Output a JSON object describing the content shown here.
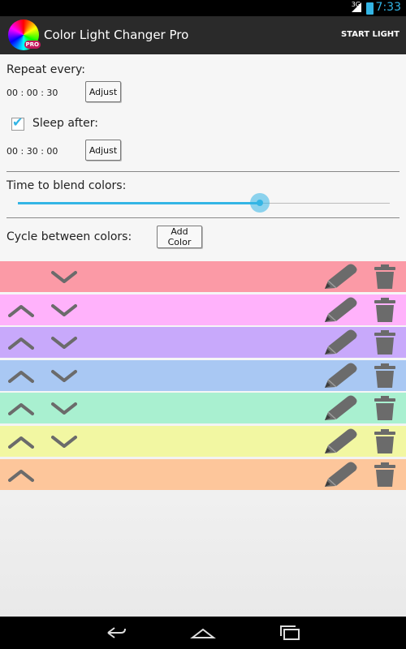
{
  "status_bar": {
    "network": "3G",
    "time": "7:33"
  },
  "action_bar": {
    "title": "Color Light Changer Pro",
    "badge": "PRO",
    "action": "START LIGHT"
  },
  "repeat": {
    "label": "Repeat every:",
    "value": "00 : 00 : 30",
    "button": "Adjust"
  },
  "sleep": {
    "label": "Sleep after:",
    "checked": true,
    "value": "00 : 30 : 00",
    "button": "Adjust"
  },
  "blend": {
    "label": "Time to blend colors:",
    "fraction": 0.65
  },
  "cycle": {
    "label": "Cycle between colors:",
    "button": "Add Color"
  },
  "colors": [
    {
      "hex": "#fb9aa6",
      "up": false,
      "down": true
    },
    {
      "hex": "#ffb2fb",
      "up": true,
      "down": true
    },
    {
      "hex": "#c8a9fb",
      "up": true,
      "down": true
    },
    {
      "hex": "#a9c8f3",
      "up": true,
      "down": true
    },
    {
      "hex": "#a9f0d0",
      "up": true,
      "down": true
    },
    {
      "hex": "#f2f7a2",
      "up": true,
      "down": true
    },
    {
      "hex": "#fdc69b",
      "up": true,
      "down": false
    }
  ],
  "icons": {
    "up": "chevron-up-icon",
    "down": "chevron-down-icon",
    "edit": "pencil-icon",
    "delete": "trash-icon",
    "back": "back-icon",
    "home": "home-icon",
    "recents": "recents-icon"
  },
  "theme": {
    "accent": "#33b5e5",
    "actionbar": "#2a2a2a",
    "icon_gray": "#6b6b6b"
  }
}
